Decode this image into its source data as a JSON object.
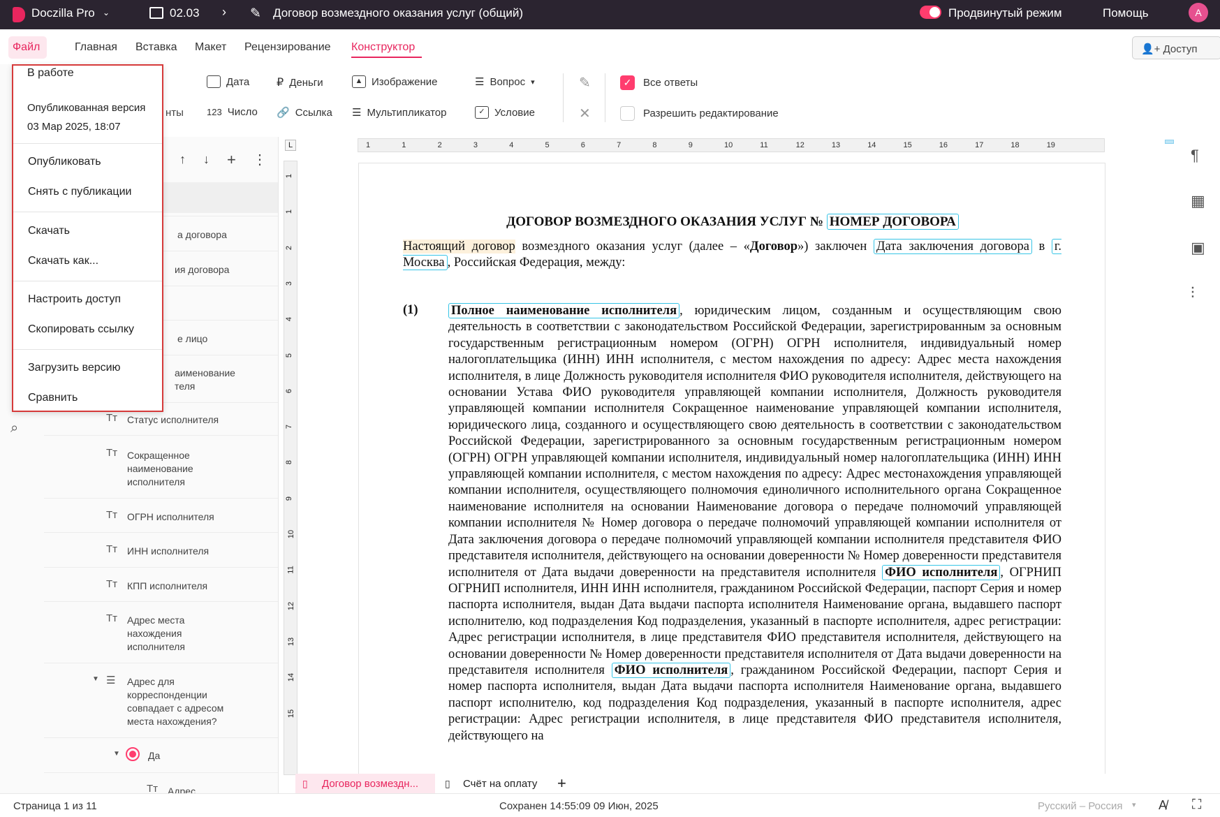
{
  "topbar": {
    "app_name": "Doczilla Pro",
    "folder": "02.03",
    "document_title": "Договор возмездного оказания услуг (общий)",
    "advanced_mode": "Продвинутый режим",
    "help": "Помощь",
    "avatar": "A",
    "accent_color": "#e8265e"
  },
  "tabs": {
    "file": "Файл",
    "home": "Главная",
    "insert": "Вставка",
    "layout": "Макет",
    "review": "Рецензирование",
    "constructor": "Конструктор",
    "access": "Доступ"
  },
  "toolbar": {
    "date": "Дата",
    "money": "Деньги",
    "image": "Изображение",
    "question": "Вопрос",
    "all_answers": "Все ответы",
    "number_prefix": "123",
    "number": "Число",
    "link": "Ссылка",
    "multiplier": "Мультипликатор",
    "condition": "Условие",
    "allow_editing": "Разрешить редактирование",
    "partial_hidden": "нты"
  },
  "file_menu": {
    "status": "В работе",
    "published_label": "Опубликованная версия",
    "published_date": "03 Мар 2025, 18:07",
    "publish": "Опубликовать",
    "unpublish": "Снять с публикации",
    "download": "Скачать",
    "download_as": "Скачать как...",
    "configure_access": "Настроить доступ",
    "copy_link": "Скопировать ссылку",
    "upload_version": "Загрузить версию",
    "compare": "Сравнить"
  },
  "side_panel": {
    "partial_items": [
      "а договора",
      "ия договора",
      "е лицо",
      "аименование",
      "теля"
    ],
    "items": [
      "Статус исполнителя",
      "Сокращенное наименование исполнителя",
      "ОГРН исполнителя",
      "ИНН исполнителя",
      "КПП исполнителя",
      "Адрес места нахождения исполнителя",
      "Адрес для корреспонденции совпадает с адресом места нахождения?",
      "Да",
      "Адрес"
    ]
  },
  "ruler": {
    "h_numbers": [
      "1",
      "1",
      "2",
      "3",
      "4",
      "5",
      "6",
      "7",
      "8",
      "9",
      "10",
      "11",
      "12",
      "13",
      "14",
      "15",
      "16",
      "17",
      "18",
      "19"
    ],
    "v_numbers": [
      "1",
      "1",
      "2",
      "3",
      "4",
      "5",
      "6",
      "7",
      "8",
      "9",
      "10",
      "11",
      "12",
      "13",
      "14",
      "15"
    ]
  },
  "document": {
    "title_static": "ДОГОВОР ВОЗМЕЗДНОГО ОКАЗАНИЯ УСЛУГ №",
    "title_field": "НОМЕР ДОГОВОРА",
    "intro_highlight": "Настоящий договор",
    "intro_1": " возмездного оказания услуг (далее – «",
    "intro_bold": "Договор",
    "intro_2": "») заключен ",
    "intro_field_date": "Дата заключения договора",
    "intro_3": " в ",
    "intro_field_city": "г. Москва",
    "intro_4": ", Российская Федерация, между:",
    "clause_number": "(1)",
    "clause_field_name": "Полное наименование исполнителя",
    "clause_text": ", юридическим лицом, созданным и осуществляющим свою деятельность в соответствии с законодательством Российской Федерации, зарегистрированным за основным государственным регистрационным номером (ОГРН) ОГРН исполнителя, индивидуальный номер налогоплательщика (ИНН) ИНН исполнителя, с местом нахождения по адресу: Адрес места нахождения исполнителя, в лице Должность руководителя исполнителя ФИО руководителя исполнителя, действующего на основании Устава ФИО руководителя управляющей компании исполнителя, Должность руководителя управляющей компании исполнителя Сокращенное наименование управляющей компании исполнителя, юридического лица, созданного и осуществляющего свою деятельность в соответствии с законодательством Российской Федерации, зарегистрированного за основным государственным регистрационным номером (ОГРН) ОГРН управляющей компании исполнителя, индивидуальный номер налогоплательщика (ИНН) ИНН управляющей компании исполнителя, с местом нахождения по адресу: Адрес местонахождения управляющей компании исполнителя, осуществляющего полномочия единоличного исполнительного органа Сокращенное наименование исполнителя на основании Наименование договора о передаче полномочий управляющей компании исполнителя № Номер договора о передаче полномочий управляющей компании исполнителя от Дата заключения договора о передаче полномочий управляющей компании исполнителя представителя ФИО представителя исполнителя, действующего на основании доверенности № Номер доверенности представителя исполнителя от Дата выдачи доверенности на представителя исполнителя ",
    "clause_bold_fio": "ФИО исполнителя",
    "clause_text_2": ", ОГРНИП ОГРНИП исполнителя, ИНН ИНН исполнителя, гражданином Российской Федерации, паспорт Серия и номер паспорта исполнителя, выдан Дата выдачи паспорта исполнителя Наименование органа, выдавшего паспорт исполнителю, код подразделения Код подразделения, указанный в паспорте исполнителя, адрес регистрации: Адрес регистрации исполнителя, в лице представителя ФИО представителя исполнителя, действующего на основании доверенности № Номер доверенности представителя исполнителя от Дата выдачи доверенности на представителя исполнителя ",
    "clause_bold_fio_2": "ФИО исполнителя",
    "clause_text_3": ", гражданином Российской Федерации, паспорт Серия и номер паспорта исполнителя, выдан Дата выдачи паспорта исполнителя Наименование органа, выдавшего паспорт исполнителю, код подразделения Код подразделения, указанный в паспорте исполнителя, адрес регистрации: Адрес регистрации исполнителя, в лице представителя ФИО представителя исполнителя, действующего на"
  },
  "doc_tabs": {
    "active": "Договор возмездн...",
    "second": "Счёт на оплату",
    "add": "+"
  },
  "status": {
    "page": "Страница 1 из 11",
    "saved": "Сохранен 14:55:09 09 Июн, 2025",
    "language": "Русский – Россия"
  }
}
